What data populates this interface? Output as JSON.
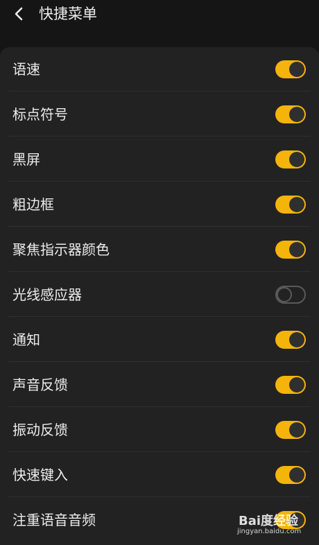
{
  "header": {
    "back_icon": "chevron-left-icon",
    "title": "快捷菜单"
  },
  "colors": {
    "background": "#151515",
    "card": "#222222",
    "toggle_on": "#f5b40c",
    "toggle_off_border": "#5a5a5a",
    "text": "#ececec"
  },
  "settings": [
    {
      "label": "语速",
      "enabled": true
    },
    {
      "label": "标点符号",
      "enabled": true
    },
    {
      "label": "黑屏",
      "enabled": true
    },
    {
      "label": "粗边框",
      "enabled": true
    },
    {
      "label": "聚焦指示器颜色",
      "enabled": true
    },
    {
      "label": "光线感应器",
      "enabled": false
    },
    {
      "label": "通知",
      "enabled": true
    },
    {
      "label": "声音反馈",
      "enabled": true
    },
    {
      "label": "振动反馈",
      "enabled": true
    },
    {
      "label": "快速键入",
      "enabled": true
    },
    {
      "label": "注重语音音频",
      "enabled": true
    }
  ],
  "watermark": {
    "logo": "Bai度经验",
    "url": "jingyan.baidu.com"
  }
}
